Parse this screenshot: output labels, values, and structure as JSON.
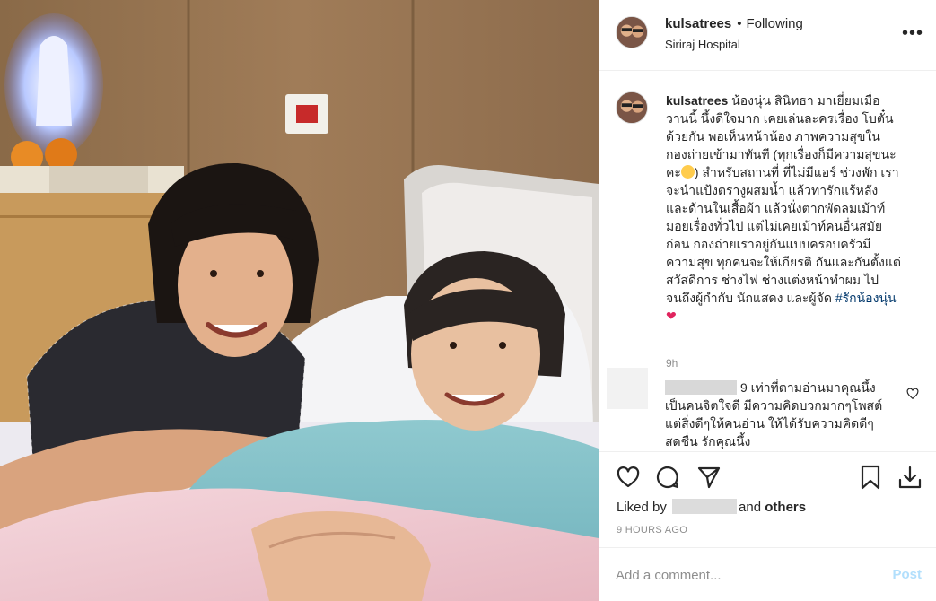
{
  "post": {
    "username": "kulsatrees",
    "follow_status": "Following",
    "separator": "•",
    "location": "Siriraj Hospital",
    "more_icon": "more-horizontal-icon"
  },
  "caption": {
    "username": "kulsatrees",
    "text": " น้องนุ่น สินิทธา มาเยี่ยมเมื่อวานนี้ นึ้งดีใจมาก เคยเล่นละครเรื่อง โบตั๋นด้วยกัน พอเห็นหน้าน้อง ภาพความสุขในกองถ่ายเข้ามาทันที (ทุกเรื่องก็มีความสุขนะคะ",
    "text_after_emoji": ") สำหรับสถานที่ ที่ไม่มีแอร์ ช่วงพัก เราจะนำแป้งตรางูผสมน้ำ แล้วทารักแร้หลัง และด้านในเสื้อผ้า แล้วนั่งตากพัดลมเม้าท์มอยเรื่องทั่วไป แต่ไม่เคยเม้าท์คนอื่นสมัยก่อน กองถ่ายเราอยู่กันแบบครอบครัวมีความสุข ทุกคนจะให้เกียรติ กันและกันตั้งแต่สวัสดิการ ช่างไฟ ช่างแต่งหน้าทำผม ไปจนถึงผู้กำกับ นักแสดง และผู้จัด ",
    "hashtag": "#รักน้องนุ่น",
    "heart": "❤",
    "time": "9h"
  },
  "comment": {
    "text": "9 เท่าที่ตามอ่านมาคุณนึ้งเป็นคนจิตใจดี มีความคิดบวกมากๆโพสต์แต่สิ่งดีๆให้คนอ่าน ให้ได้รับความคิดดีๆสดชื่น รักคุณนึ้ง"
  },
  "actions": {
    "icons": [
      "heart-icon",
      "comment-icon",
      "share-icon",
      "bookmark-icon",
      "download-icon"
    ],
    "liked_by_prefix": "Liked by",
    "liked_by_suffix": "and",
    "others": "others",
    "time_ago": "9 HOURS AGO"
  },
  "add_comment": {
    "placeholder": "Add a comment...",
    "post_label": "Post"
  },
  "colors": {
    "accent_post_disabled": "#b2dffc",
    "hashtag": "#00376b",
    "muted": "#8e8e8e",
    "heart_red": "#e0245e"
  }
}
